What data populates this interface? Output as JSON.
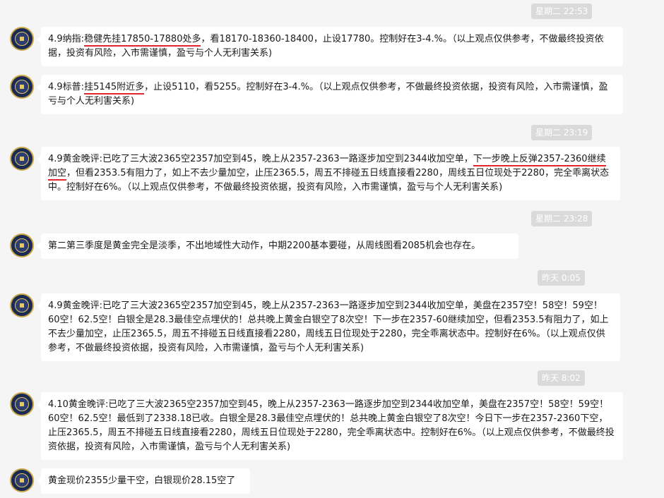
{
  "colors": {
    "highlight_underline": "#e0262b",
    "background": "#f5f5f5",
    "bubble": "#ffffff",
    "timestamp_bg": "#dadada"
  },
  "timestamps": [
    "星期二 22:53",
    "星期二 23:19",
    "星期二 23:28",
    "昨天 0:05",
    "昨天 8:02"
  ],
  "messages": [
    {
      "a": "4.9纳指:",
      "b": "稳健先挂17850-17880处多",
      "c": "，看18170-18360-18400，止设17780。控制好在3-4.%。（以上观点仅供参考，不做最终投资依据，投资有风险，入市需谨慎，盈亏与个人无利害关系)"
    },
    {
      "a": "4.9标普:",
      "b": "挂5145附近多",
      "c": "，止设5110，看5255。控制好在3-4.%。（以上观点仅供参考，不做最终投资依据，投资有风险，入市需谨慎，盈亏与个人无利害关系)"
    },
    {
      "a": "4.9黄金晚评:已吃了三大波2365空2357加空到45，晚上从2357-2363一路逐步加空到2344收加空单，",
      "b": "下一步晚上反弹2357-2360继续加空",
      "c": "，但看2353.5有阻力了，如上不去少量加空，止压2365.5，周五不排碰五日线直接看2280，周线五日位现处于2280，完全乖离状态中。控制好在6%。（以上观点仅供参考，不做最终投资依据，投资有风险，入市需谨慎，盈亏与个人无利害关系)"
    },
    {
      "text": "第二第三季度是黄金完全是淡季，不出地域性大动作，中期2200基本要碰，从周线图看2085机会也存在。"
    },
    {
      "text": "4.9黄金晚评:已吃了三大波2365空2357加空到45，晚上从2357-2363一路逐步加空到2344收加空单，美盘在2357空！58空！59空！60空！62.5空！白银全是28.3最佳空点埋伏的！总共晚上黄金白银空了8次空！下一步在2357-60继续加空，但看2353.5有阻力了，如上不去少量加空，止压2365.5，周五不排碰五日线直接看2280，周线五日位现处于2280，完全乖离状态中。控制好在6%。（以上观点仅供参考，不做最终投资依据，投资有风险，入市需谨慎，盈亏与个人无利害关系)"
    },
    {
      "text": "4.10黄金晚评:已吃了三大波2365空2357加空到45，晚上从2357-2363一路逐步加空到2344收加空单，美盘在2357空！58空！59空！60空！62.5空！最低到了2338.18已收。白银全是28.3最佳空点埋伏的！总共晚上黄金白银空了8次空！今日下一步在2357-2360下空，止压2365.5，周五不排碰五日线直接看2280，周线五日位现处于2280，完全乖离状态中。控制好在6%。（以上观点仅供参考，不做最终投资依据，投资有风险，入市需谨慎，盈亏与个人无利害关系)"
    },
    {
      "text": "黄金现价2355少量干空，白银现价28.15空了"
    }
  ]
}
